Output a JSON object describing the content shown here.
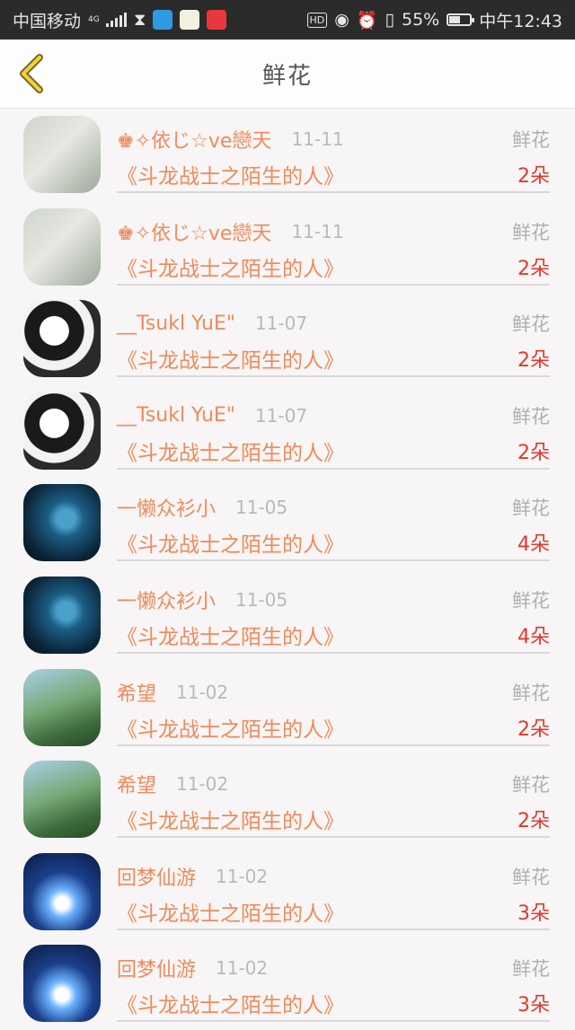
{
  "status_bar": {
    "carrier": "中国移动",
    "network": "4G",
    "hd": "HD",
    "battery_percent": "55%",
    "battery_level": 0.55,
    "time": "中午12:43"
  },
  "nav": {
    "title": "鲜花"
  },
  "items": [
    {
      "avatar": "a",
      "name": "♚✧依じ☆ve戀天",
      "date": "11-11",
      "type": "鲜花",
      "book": "《斗龙战士之陌生的人》",
      "count": "2朵"
    },
    {
      "avatar": "a",
      "name": "♚✧依じ☆ve戀天",
      "date": "11-11",
      "type": "鲜花",
      "book": "《斗龙战士之陌生的人》",
      "count": "2朵"
    },
    {
      "avatar": "b",
      "name": "__Tsukl YuE\"",
      "date": "11-07",
      "type": "鲜花",
      "book": "《斗龙战士之陌生的人》",
      "count": "2朵"
    },
    {
      "avatar": "b",
      "name": "__Tsukl YuE\"",
      "date": "11-07",
      "type": "鲜花",
      "book": "《斗龙战士之陌生的人》",
      "count": "2朵"
    },
    {
      "avatar": "c",
      "name": "一懒众衫小",
      "date": "11-05",
      "type": "鲜花",
      "book": "《斗龙战士之陌生的人》",
      "count": "4朵"
    },
    {
      "avatar": "c",
      "name": "一懒众衫小",
      "date": "11-05",
      "type": "鲜花",
      "book": "《斗龙战士之陌生的人》",
      "count": "4朵"
    },
    {
      "avatar": "d",
      "name": "希望",
      "date": "11-02",
      "type": "鲜花",
      "book": "《斗龙战士之陌生的人》",
      "count": "2朵"
    },
    {
      "avatar": "d",
      "name": "希望",
      "date": "11-02",
      "type": "鲜花",
      "book": "《斗龙战士之陌生的人》",
      "count": "2朵"
    },
    {
      "avatar": "e",
      "name": "回梦仙游",
      "date": "11-02",
      "type": "鲜花",
      "book": "《斗龙战士之陌生的人》",
      "count": "3朵"
    },
    {
      "avatar": "e",
      "name": "回梦仙游",
      "date": "11-02",
      "type": "鲜花",
      "book": "《斗龙战士之陌生的人》",
      "count": "3朵"
    }
  ]
}
